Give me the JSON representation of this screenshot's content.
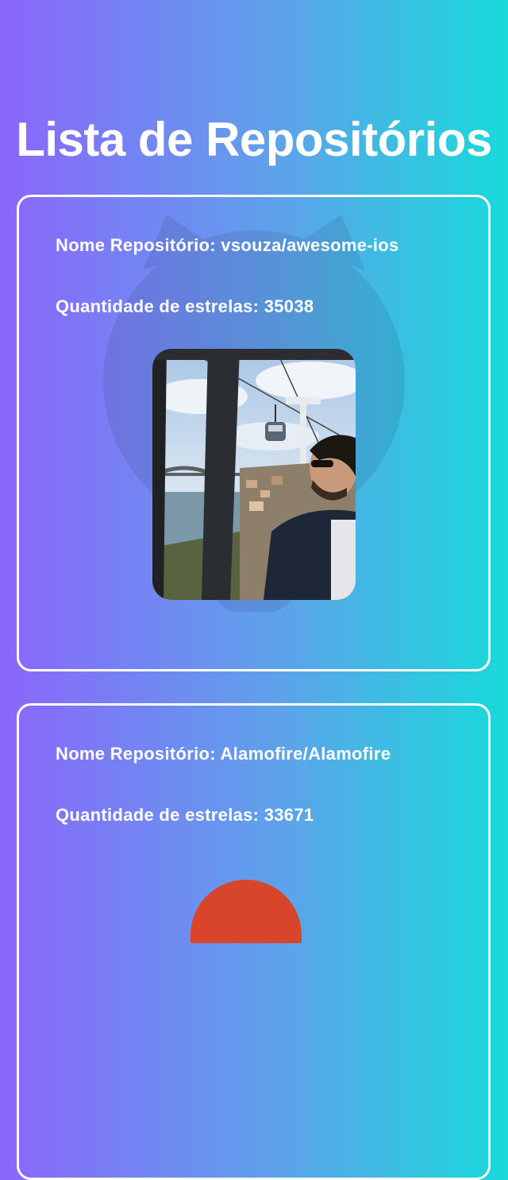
{
  "page": {
    "title": "Lista de Repositórios"
  },
  "repositories": [
    {
      "name_label": "Nome Repositório: vsouza/awesome-ios",
      "stars_label": "Quantidade de estrelas: 35038",
      "avatar": "owner-photo"
    },
    {
      "name_label": "Nome Repositório: Alamofire/Alamofire",
      "stars_label": "Quantidade de estrelas: 33671",
      "avatar": "owner-logo"
    }
  ],
  "colors": {
    "gradient_start": "#8a66fb",
    "gradient_mid": "#5ea2ea",
    "gradient_end": "#18dada",
    "card_border": "#ffffff",
    "second_avatar": "#d9452b"
  }
}
